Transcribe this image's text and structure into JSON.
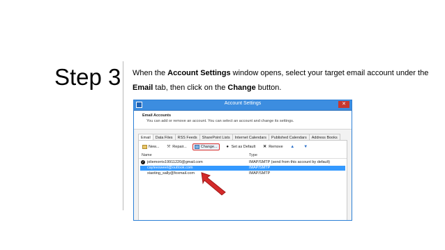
{
  "slide": {
    "step_label": "Step 3",
    "instruction": {
      "part1": "When the ",
      "bold1": "Account Settings",
      "part2": " window opens, select your target email account under the ",
      "bold2": "Email",
      "part3": " tab, then click on the ",
      "bold3": "Change",
      "part4": " button."
    }
  },
  "dialog": {
    "title": "Account Settings",
    "close_label": "✕",
    "header": {
      "title": "Email Accounts",
      "description": "You can add or remove an account. You can select an account and change its settings."
    },
    "tabs": [
      {
        "label": "Email"
      },
      {
        "label": "Data Files"
      },
      {
        "label": "RSS Feeds"
      },
      {
        "label": "SharePoint Lists"
      },
      {
        "label": "Internet Calendars"
      },
      {
        "label": "Published Calendars"
      },
      {
        "label": "Address Books"
      }
    ],
    "toolbar": {
      "new": "New...",
      "repair": "Repair...",
      "change": "Change...",
      "set_default": "Set as Default",
      "remove": "Remove"
    },
    "columns": {
      "name": "Name",
      "type": "Type"
    },
    "accounts": [
      {
        "name": "joliemorris19911220@gmail.com",
        "type": "IMAP/SMTP (send from this account by default)",
        "default": true
      },
      {
        "name": "cayleesweet@outlook.com",
        "type": "IMAP/SMTP",
        "selected": true
      },
      {
        "name": "xiaoting_sally@foxmail.com",
        "type": "IMAP/SMTP"
      }
    ],
    "accent_color": "#3399ff",
    "highlight_color": "#d42a2a"
  }
}
